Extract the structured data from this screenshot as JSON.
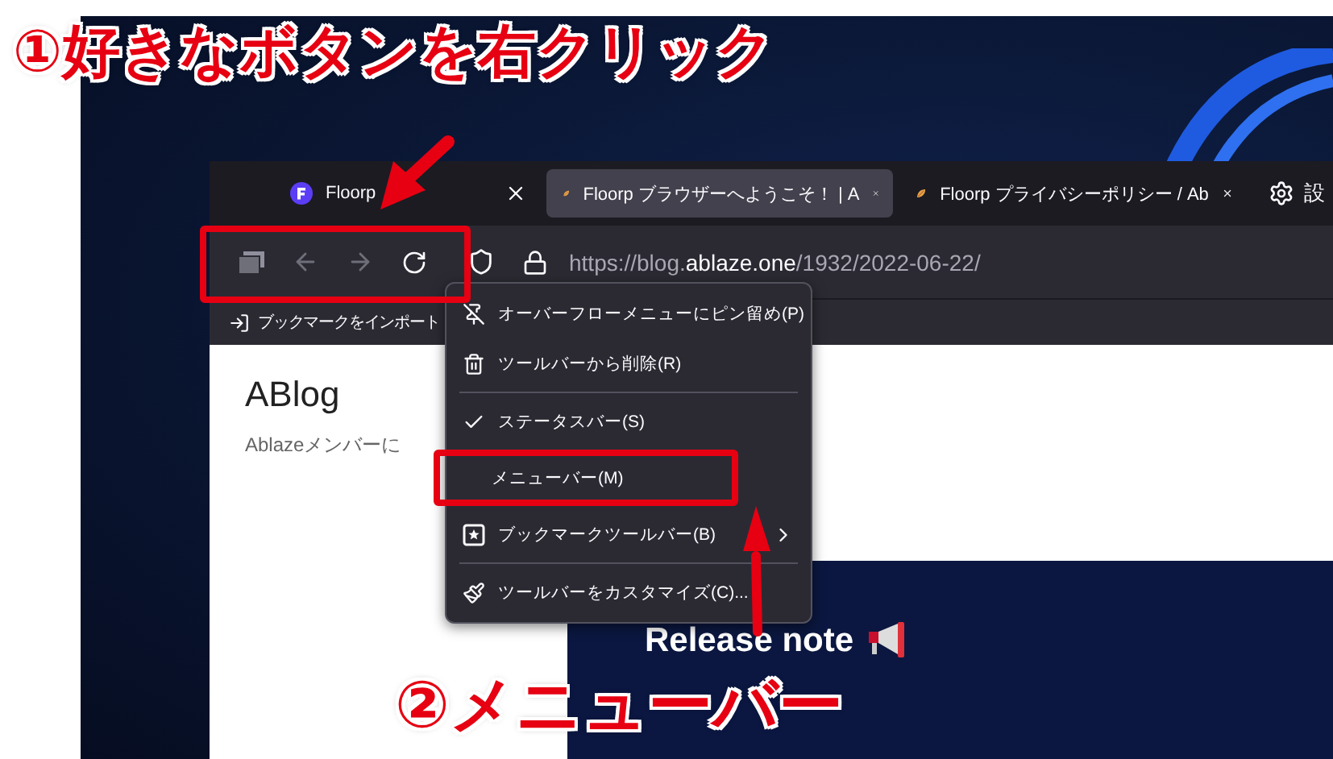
{
  "annotations": {
    "step_1": "①好きなボタンを右クリック",
    "step_2": "②メニューバー"
  },
  "tabs": [
    {
      "title": "Floorp",
      "selected": false
    },
    {
      "title": "Floorp ブラウザーへようこそ！ | A",
      "selected": true
    },
    {
      "title": "Floorp プライバシーポリシー / Ab",
      "selected": false
    }
  ],
  "settings_tab": {
    "label": "設"
  },
  "address_bar": {
    "url": "https://blog.**ablaze.one**/1932/2022-06-22/"
  },
  "bookmarks_bar": {
    "items": [
      "ブックマークをインポート"
    ]
  },
  "page": {
    "site_title": "ABlog",
    "tagline": "Ablazeメンバーに",
    "hero_heading": "Release note"
  },
  "context_menu": {
    "items": [
      {
        "kind": "action",
        "label": "オーバーフローメニューにピン留め(P)"
      },
      {
        "kind": "action",
        "label": "ツールバーから削除(R)"
      },
      {
        "kind": "separator"
      },
      {
        "kind": "check",
        "label": "ステータスバー(S)",
        "checked": true
      },
      {
        "kind": "check",
        "label": "メニューバー(M)",
        "checked": false
      },
      {
        "kind": "submenu",
        "label": "ブックマークツールバー(B)"
      },
      {
        "kind": "separator"
      },
      {
        "kind": "action",
        "label": "ツールバーをカスタマイズ(C)..."
      }
    ]
  }
}
